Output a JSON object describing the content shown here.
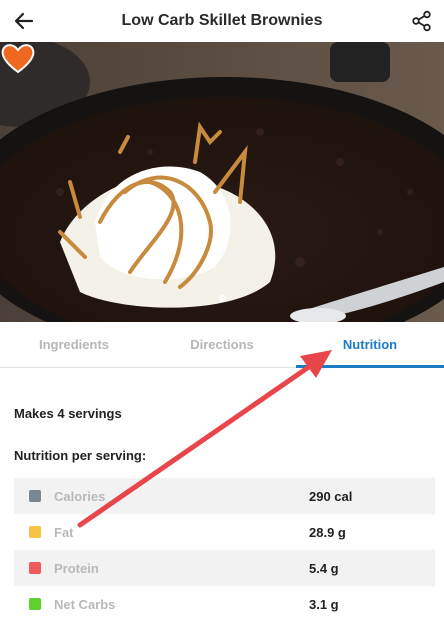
{
  "header": {
    "title": "Low Carb Skillet Brownies",
    "back_icon": "arrow-left-icon",
    "share_icon": "share-icon"
  },
  "hero": {
    "image_alt": "",
    "favorite_icon": "heart-icon",
    "favorite_color": "#f0681f",
    "carousel_total": 1,
    "carousel_active": 1
  },
  "tabs": [
    {
      "label": "Ingredients",
      "active": false
    },
    {
      "label": "Directions",
      "active": false
    },
    {
      "label": "Nutrition",
      "active": true
    }
  ],
  "nutrition": {
    "servings_text": "Makes 4 servings",
    "per_serving_heading": "Nutrition per serving:",
    "rows": [
      {
        "name": "Calories",
        "value": "290 cal",
        "color": "#7a8791"
      },
      {
        "name": "Fat",
        "value": "28.9 g",
        "color": "#f6c343"
      },
      {
        "name": "Protein",
        "value": "5.4 g",
        "color": "#ef5b5b"
      },
      {
        "name": "Net Carbs",
        "value": "3.1 g",
        "color": "#5fd12d"
      }
    ]
  },
  "colors": {
    "accent": "#1b7dc4",
    "annotation_arrow": "#e8464b"
  }
}
